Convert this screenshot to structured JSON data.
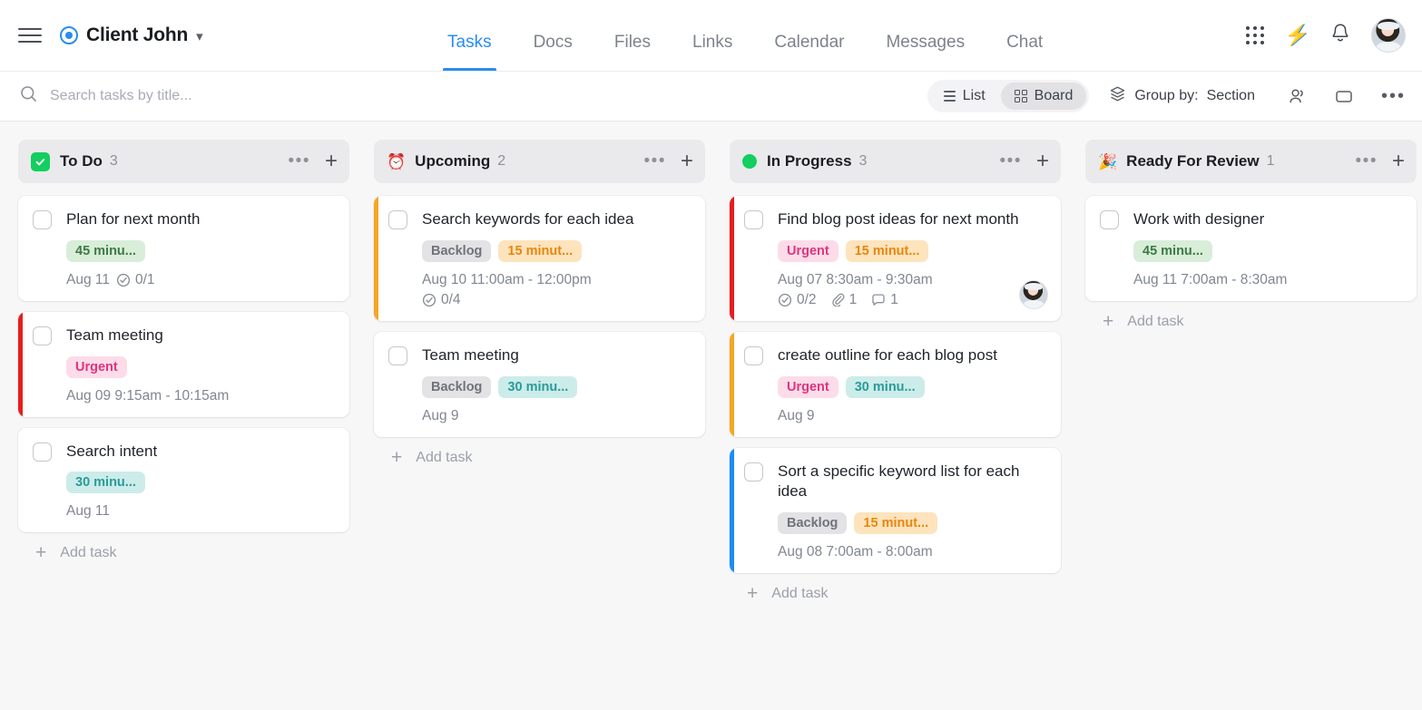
{
  "header": {
    "menu_icon": "hamburger-icon",
    "workspace_name": "Client John",
    "workspace_icon": "target-icon",
    "chevron": "⌄",
    "nav": [
      {
        "label": "Tasks",
        "active": true
      },
      {
        "label": "Docs",
        "active": false
      },
      {
        "label": "Files",
        "active": false
      },
      {
        "label": "Links",
        "active": false
      },
      {
        "label": "Calendar",
        "active": false
      },
      {
        "label": "Messages",
        "active": false
      },
      {
        "label": "Chat",
        "active": false
      }
    ],
    "apps_icon": "grid-apps-icon",
    "bolt_icon": "lightning-bolt-icon",
    "bolt_glyph": "⚡",
    "bell_icon": "notification-bell-icon",
    "avatar_icon": "user-avatar"
  },
  "toolbar": {
    "search_placeholder": "Search tasks by title...",
    "search_value": "",
    "views": [
      {
        "label": "List",
        "active": false
      },
      {
        "label": "Board",
        "active": true
      }
    ],
    "group_by_label": "Group by:",
    "group_by_value": "Section",
    "assignee_icon": "people-icon",
    "tag_icon": "tag-icon",
    "more_icon": "more-horizontal-icon",
    "more_glyph": "•••"
  },
  "colors": {
    "accent": "#2a8cf0",
    "green": "#12cf5f",
    "bar_red": "#e81d1d",
    "bar_orange": "#f5a623",
    "bar_blue": "#1b8cf5"
  },
  "board": {
    "add_task_label": "Add task",
    "columns": [
      {
        "title": "To Do",
        "count": "3",
        "marker": "checkbox",
        "emoji": "",
        "cards": [
          {
            "title": "Plan for next month",
            "bar": "",
            "tags": [
              {
                "label": "45 minu...",
                "style": "green"
              }
            ],
            "date": "Aug 11",
            "checklist": "0/1",
            "attachments": "",
            "comments": "",
            "avatar": false
          },
          {
            "title": "Team meeting",
            "bar": "#e81d1d",
            "tags": [
              {
                "label": "Urgent",
                "style": "pink"
              }
            ],
            "date": "Aug 09 9:15am - 10:15am",
            "checklist": "",
            "attachments": "",
            "comments": "",
            "avatar": false
          },
          {
            "title": "Search intent",
            "bar": "",
            "tags": [
              {
                "label": "30 minu...",
                "style": "teal"
              }
            ],
            "date": "Aug 11",
            "checklist": "",
            "attachments": "",
            "comments": "",
            "avatar": false
          }
        ]
      },
      {
        "title": "Upcoming",
        "count": "2",
        "marker": "emoji",
        "emoji": "⏰",
        "cards": [
          {
            "title": "Search keywords for each idea",
            "bar": "#f5a623",
            "tags": [
              {
                "label": "Backlog",
                "style": "gray"
              },
              {
                "label": "15 minut...",
                "style": "orange"
              }
            ],
            "date": "Aug 10 11:00am - 12:00pm",
            "checklist": "0/4",
            "attachments": "",
            "comments": "",
            "avatar": false
          },
          {
            "title": "Team meeting",
            "bar": "",
            "tags": [
              {
                "label": "Backlog",
                "style": "gray"
              },
              {
                "label": "30 minu...",
                "style": "teal"
              }
            ],
            "date": "Aug 9",
            "checklist": "",
            "attachments": "",
            "comments": "",
            "avatar": false
          }
        ]
      },
      {
        "title": "In Progress",
        "count": "3",
        "marker": "dot",
        "emoji": "",
        "cards": [
          {
            "title": "Find blog post ideas for next month",
            "bar": "#e81d1d",
            "tags": [
              {
                "label": "Urgent",
                "style": "pink"
              },
              {
                "label": "15 minut...",
                "style": "orange"
              }
            ],
            "date": "Aug 07 8:30am - 9:30am",
            "checklist": "0/2",
            "attachments": "1",
            "comments": "1",
            "avatar": true
          },
          {
            "title": "create outline for each blog post",
            "bar": "#f5a623",
            "tags": [
              {
                "label": "Urgent",
                "style": "pink"
              },
              {
                "label": "30 minu...",
                "style": "teal"
              }
            ],
            "date": "Aug 9",
            "checklist": "",
            "attachments": "",
            "comments": "",
            "avatar": false
          },
          {
            "title": "Sort a specific keyword list for each idea",
            "bar": "#1b8cf5",
            "tags": [
              {
                "label": "Backlog",
                "style": "gray"
              },
              {
                "label": "15 minut...",
                "style": "orange"
              }
            ],
            "date": "Aug 08 7:00am - 8:00am",
            "checklist": "",
            "attachments": "",
            "comments": "",
            "avatar": false
          }
        ]
      },
      {
        "title": "Ready For Review",
        "count": "1",
        "marker": "emoji",
        "emoji": "🎉",
        "cards": [
          {
            "title": "Work with designer",
            "bar": "",
            "tags": [
              {
                "label": "45 minu...",
                "style": "green"
              }
            ],
            "date": "Aug 11 7:00am - 8:30am",
            "checklist": "",
            "attachments": "",
            "comments": "",
            "avatar": false
          }
        ]
      }
    ]
  }
}
